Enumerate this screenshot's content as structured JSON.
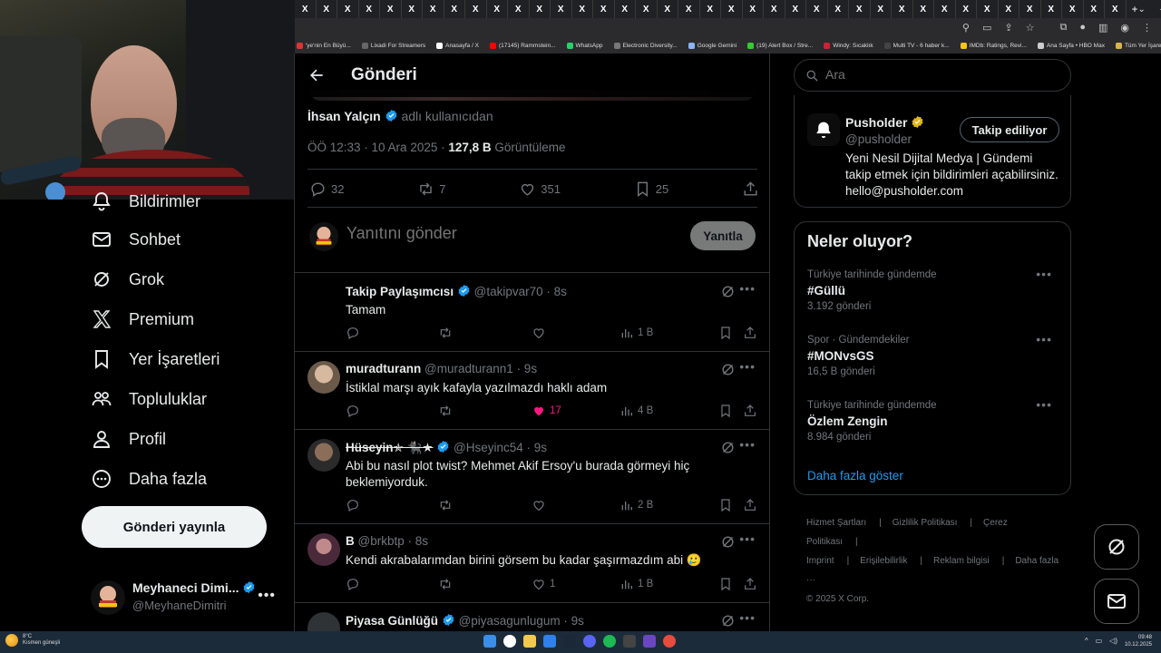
{
  "browser": {
    "tab_labels": [
      "X",
      "X",
      "X",
      "X",
      "X",
      "X",
      "X",
      "X",
      "X",
      "X",
      "X",
      "X",
      "X",
      "X",
      "X",
      "X",
      "X",
      "X",
      "X",
      "X",
      "X",
      "X",
      "X",
      "X",
      "X",
      "X",
      "X",
      "X",
      "X",
      "X",
      "X",
      "X",
      "X",
      "X",
      "X",
      "X",
      "X",
      "X",
      "X"
    ],
    "bookmarks": [
      {
        "label": "'ye'nin En Büyü...",
        "color": "#d33"
      },
      {
        "label": "Lixadi For Streamers",
        "color": "#666"
      },
      {
        "label": "Anasayfa / X",
        "color": "#fff"
      },
      {
        "label": "(17145) Rammstein...",
        "color": "#f00"
      },
      {
        "label": "WhatsApp",
        "color": "#25d366"
      },
      {
        "label": "Electronic Diversity...",
        "color": "#777"
      },
      {
        "label": "Google Gemini",
        "color": "#8ab4f8"
      },
      {
        "label": "(19) Alert Box / Stre...",
        "color": "#3c3"
      },
      {
        "label": "Windy: Sıcaklık",
        "color": "#c23"
      },
      {
        "label": "Multi TV - 6 haber k...",
        "color": "#444"
      },
      {
        "label": "IMDb: Ratings, Revi...",
        "color": "#f5c518"
      },
      {
        "label": "Ana Sayfa • HBO Max",
        "color": "#ccc"
      }
    ],
    "all_bookmarks": "Tüm Yer İşaretleri"
  },
  "nav": {
    "items": [
      {
        "label": "Bildirimler",
        "icon": "bell-icon"
      },
      {
        "label": "Sohbet",
        "icon": "mail-icon"
      },
      {
        "label": "Grok",
        "icon": "grok-icon"
      },
      {
        "label": "Premium",
        "icon": "x-logo-icon"
      },
      {
        "label": "Yer İşaretleri",
        "icon": "bookmark-icon"
      },
      {
        "label": "Topluluklar",
        "icon": "people-icon"
      },
      {
        "label": "Profil",
        "icon": "person-icon"
      },
      {
        "label": "Daha fazla",
        "icon": "more-circle-icon"
      }
    ],
    "post_button": "Gönderi yayınla",
    "account": {
      "name": "Meyhaneci Dimi...",
      "handle": "@MeyhaneDimitri"
    }
  },
  "header": {
    "title": "Gönderi"
  },
  "post": {
    "author": "İhsan Yalçın",
    "by_suffix": "adlı kullanıcıdan",
    "time": "ÖÖ 12:33 · 10 Ara 2025 ·",
    "views": "127,8 B",
    "views_label": "Görüntüleme",
    "stats": {
      "replies": "32",
      "reposts": "7",
      "likes": "351",
      "bookmarks": "25"
    }
  },
  "reply_box": {
    "placeholder": "Yanıtını gönder",
    "button": "Yanıtla"
  },
  "replies": [
    {
      "name": "Takip Paylaşımcısı",
      "handle": "@takipvar70",
      "time": "· 8s",
      "text": "Tamam",
      "likes": "",
      "views": "1 B",
      "liked": false
    },
    {
      "name": "muradturann",
      "handle": "@muradturann1",
      "time": "· 9s",
      "text": "İstiklal marşı ayık kafayla yazılmazdı haklı adam",
      "likes": "17",
      "views": "4 B",
      "liked": true
    },
    {
      "name": "Hüseyin✯ 🐈‍⬛★",
      "handle": "@Hseyinc54",
      "time": "· 9s",
      "text": "Abi bu nasıl plot twist? Mehmet Akif Ersoy'u burada görmeyi hiç beklemiyorduk.",
      "likes": "",
      "views": "2 B",
      "liked": false
    },
    {
      "name": "B",
      "handle": "@brkbtp",
      "time": "· 8s",
      "text": "Kendi akrabalarımdan birini görsem bu kadar şaşırmazdım abi 🥲",
      "likes": "1",
      "views": "1 B",
      "liked": false
    },
    {
      "name": "Piyasa Günlüğü",
      "handle": "@piyasagunlugum",
      "time": "· 9s",
      "text": "",
      "likes": "",
      "views": "",
      "liked": false
    }
  ],
  "search": {
    "placeholder": "Ara"
  },
  "pusholder": {
    "name": "Pusholder",
    "handle": "@pusholder",
    "follow_button": "Takip ediliyor",
    "bio": "Yeni Nesil Dijital Medya | Gündemi takip etmek için bildirimleri açabilirsiniz. hello@pusholder.com"
  },
  "trends": {
    "title": "Neler oluyor?",
    "items": [
      {
        "context": "Türkiye tarihinde gündemde",
        "name": "#Güllü",
        "count": "3.192 gönderi"
      },
      {
        "context": "Spor · Gündemdekiler",
        "name": "#MONvsGS",
        "count": "16,5 B gönderi"
      },
      {
        "context": "Türkiye tarihinde gündemde",
        "name": "Özlem Zengin",
        "count": "8.984 gönderi"
      }
    ],
    "show_more": "Daha fazla göster"
  },
  "footer": {
    "links": [
      "Hizmet Şartları",
      "|",
      "Gizlilik Politikası",
      "|",
      "Çerez Politikası",
      "|",
      "Imprint",
      "|",
      "Erişilebilirlik",
      "|",
      "Reklam bilgisi",
      "|",
      "Daha fazla ···"
    ],
    "copyright": "© 2025 X Corp."
  },
  "taskbar": {
    "temp": "8°C",
    "weather": "Kısmen güneşli",
    "time": "09:48",
    "date": "10.12.2025"
  },
  "colors": {
    "accent": "#1d9bf0",
    "like": "#f91880",
    "gold": "#e2b719"
  }
}
